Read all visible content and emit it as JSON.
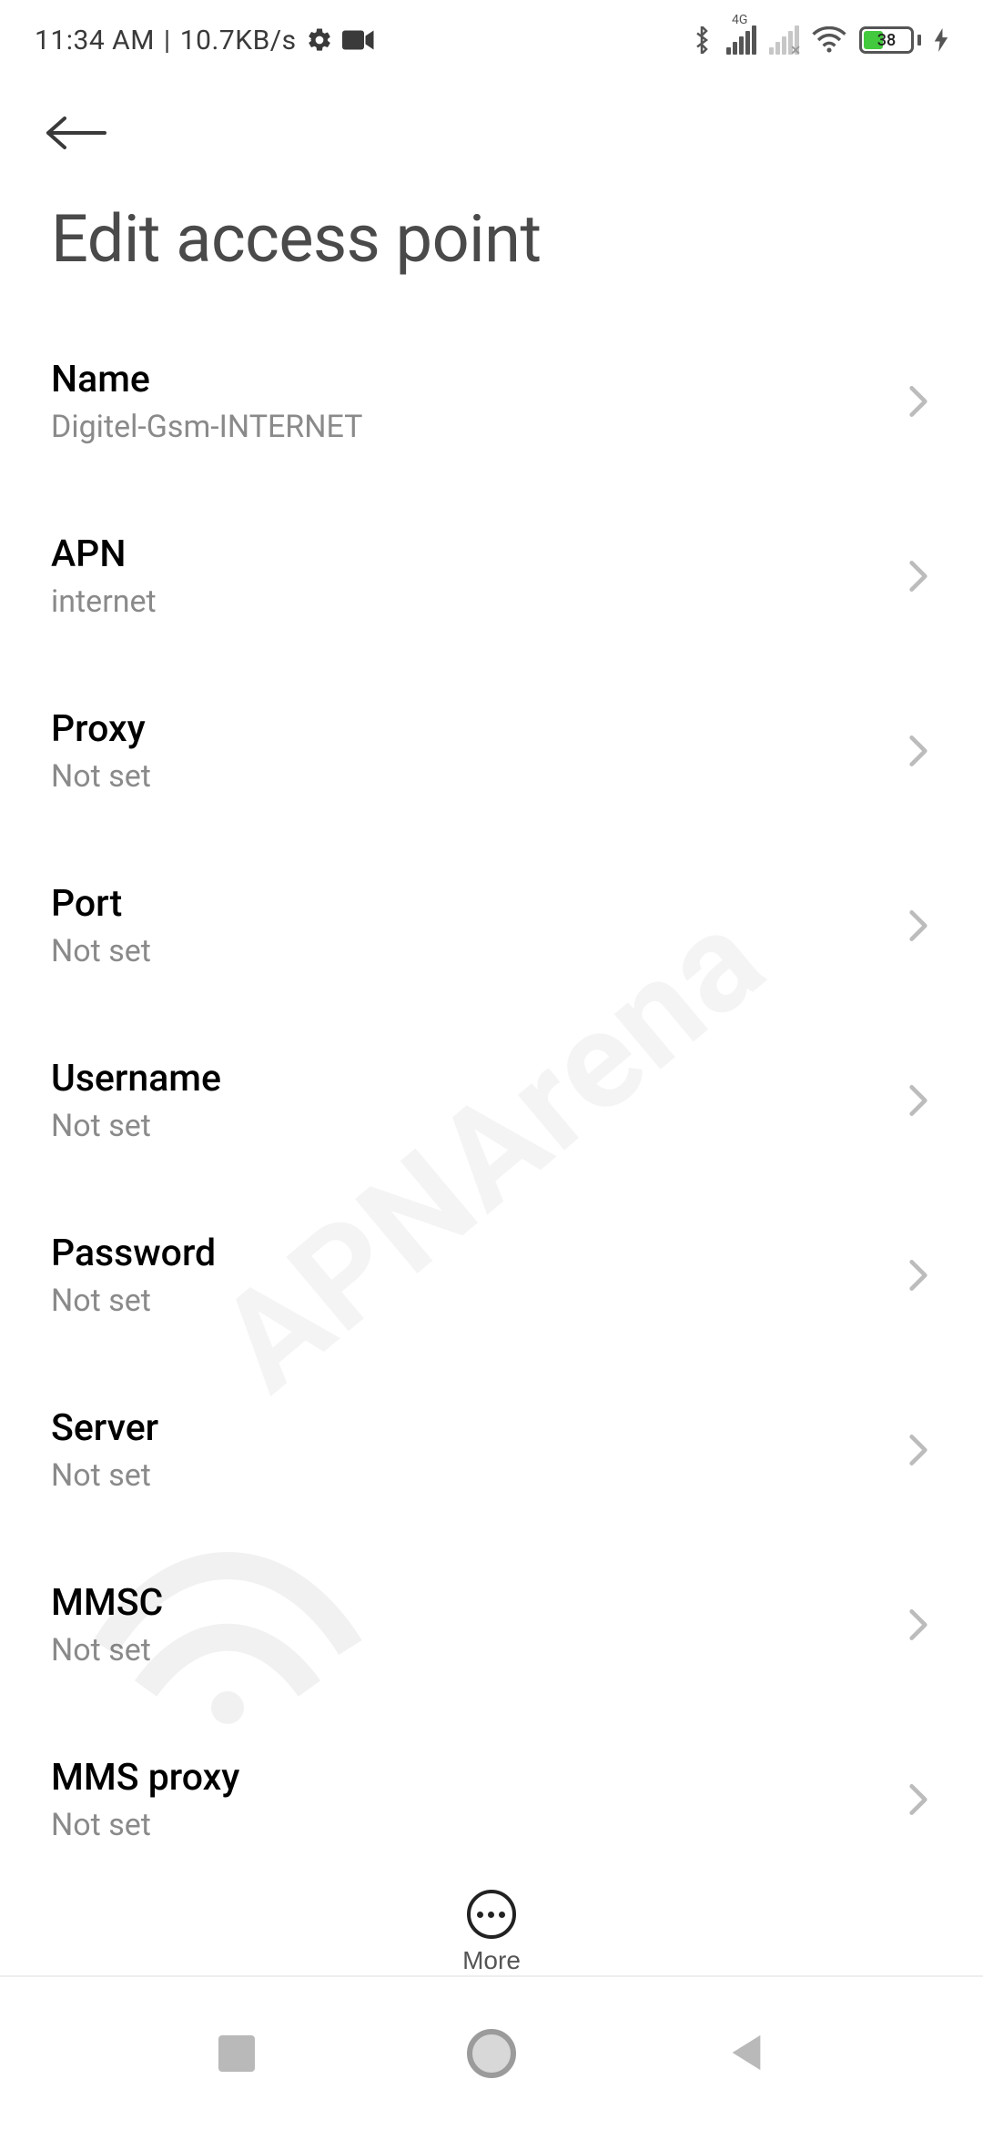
{
  "status_bar": {
    "time": "11:34 AM",
    "separator": "|",
    "net_speed": "10.7KB/s",
    "network_type_label": "4G",
    "battery_percent": "38"
  },
  "header": {
    "title": "Edit access point"
  },
  "settings": [
    {
      "id": "name",
      "label": "Name",
      "value": "Digitel-Gsm-INTERNET"
    },
    {
      "id": "apn",
      "label": "APN",
      "value": "internet"
    },
    {
      "id": "proxy",
      "label": "Proxy",
      "value": "Not set"
    },
    {
      "id": "port",
      "label": "Port",
      "value": "Not set"
    },
    {
      "id": "username",
      "label": "Username",
      "value": "Not set"
    },
    {
      "id": "password",
      "label": "Password",
      "value": "Not set"
    },
    {
      "id": "server",
      "label": "Server",
      "value": "Not set"
    },
    {
      "id": "mmsc",
      "label": "MMSC",
      "value": "Not set"
    },
    {
      "id": "mms-proxy",
      "label": "MMS proxy",
      "value": "Not set"
    }
  ],
  "footer": {
    "more_label": "More"
  },
  "watermark": {
    "text": "APNArena"
  }
}
